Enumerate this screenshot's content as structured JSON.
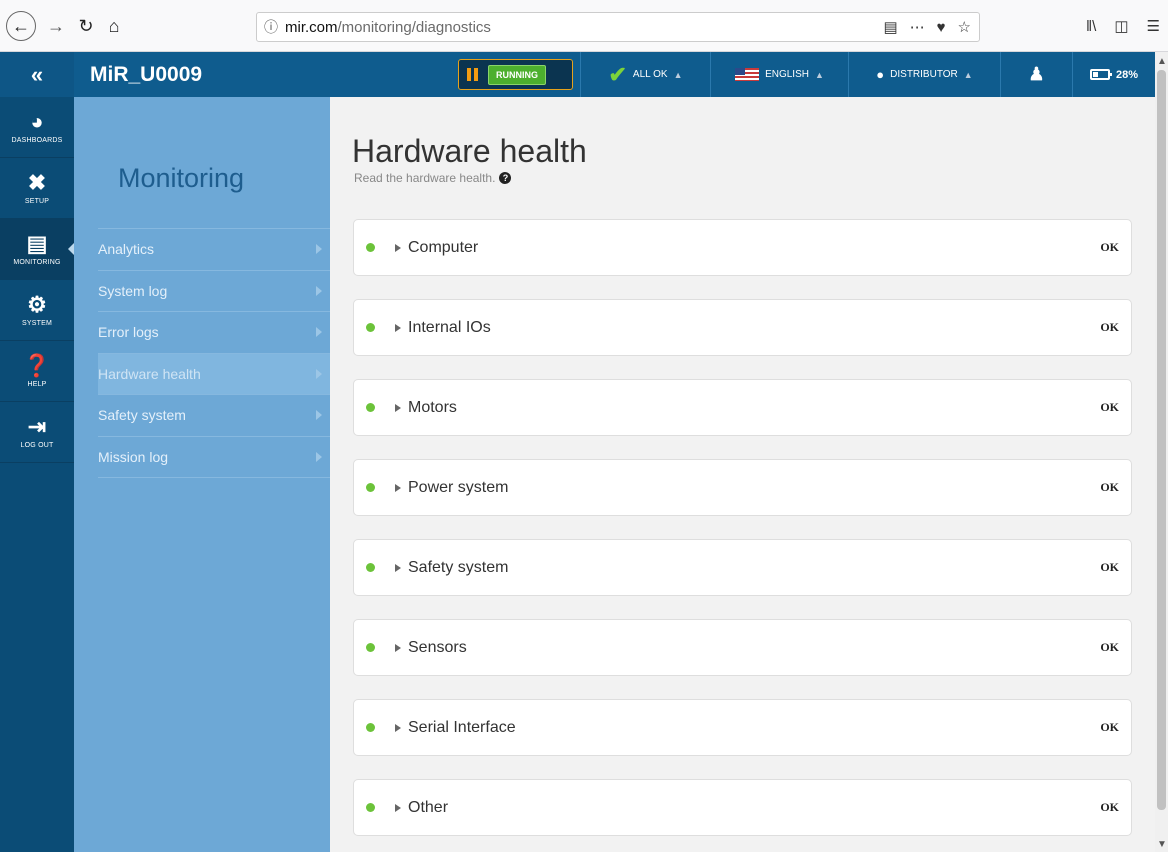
{
  "browser": {
    "url_domain": "mir.com",
    "url_path": "/monitoring/diagnostics"
  },
  "header": {
    "robot_name": "MiR_U0009",
    "run_state": "RUNNING",
    "status": "ALL OK",
    "language": "ENGLISH",
    "user_role": "DISTRIBUTOR",
    "battery": "28%"
  },
  "rail": [
    {
      "label": "DASHBOARDS",
      "icon": "dashboard-icon"
    },
    {
      "label": "SETUP",
      "icon": "tools-icon"
    },
    {
      "label": "MONITORING",
      "icon": "chart-icon"
    },
    {
      "label": "SYSTEM",
      "icon": "gear-icon"
    },
    {
      "label": "HELP",
      "icon": "help-icon"
    },
    {
      "label": "LOG OUT",
      "icon": "logout-icon"
    }
  ],
  "subnav": {
    "title": "Monitoring",
    "items": [
      {
        "label": "Analytics"
      },
      {
        "label": "System log"
      },
      {
        "label": "Error logs"
      },
      {
        "label": "Hardware health"
      },
      {
        "label": "Safety system"
      },
      {
        "label": "Mission log"
      }
    ]
  },
  "main": {
    "title": "Hardware health",
    "subtitle": "Read the hardware health.",
    "panels": [
      {
        "label": "Computer",
        "status": "OK"
      },
      {
        "label": "Internal IOs",
        "status": "OK"
      },
      {
        "label": "Motors",
        "status": "OK"
      },
      {
        "label": "Power system",
        "status": "OK"
      },
      {
        "label": "Safety system",
        "status": "OK"
      },
      {
        "label": "Sensors",
        "status": "OK"
      },
      {
        "label": "Serial Interface",
        "status": "OK"
      },
      {
        "label": "Other",
        "status": "OK"
      }
    ]
  },
  "colors": {
    "header_bg": "#0f5c8e",
    "rail_bg": "#0b4c76",
    "subnav_bg": "#6da8d6",
    "status_ok": "#6cc33a",
    "running": "#4caf2e"
  }
}
